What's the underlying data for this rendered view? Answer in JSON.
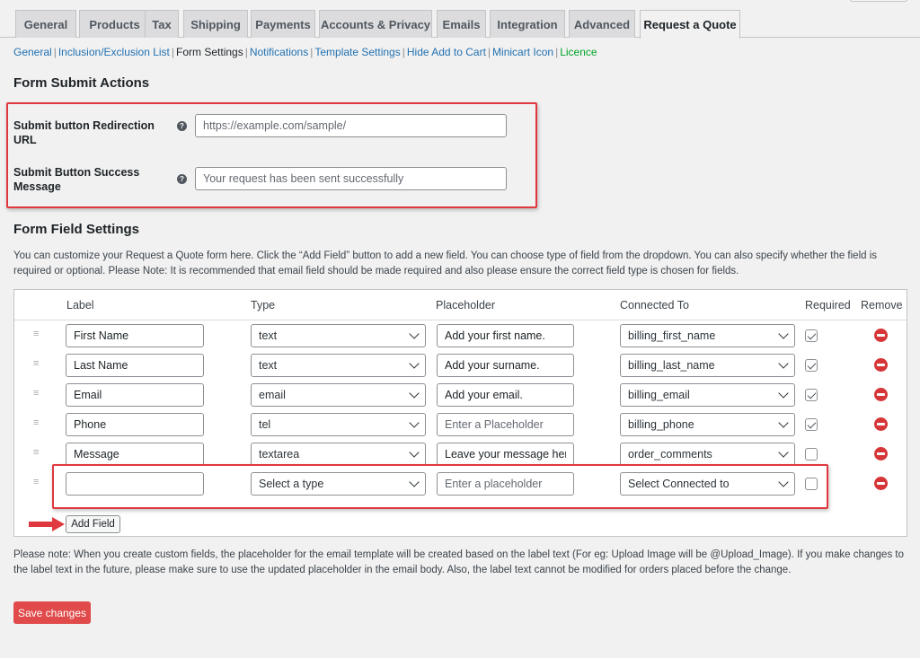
{
  "tabs": [
    "General",
    "Products",
    "Tax",
    "Shipping",
    "Payments",
    "Accounts & Privacy",
    "Emails",
    "Integration",
    "Advanced",
    "Request a Quote"
  ],
  "active_tab": "Request a Quote",
  "subnav": {
    "items": [
      "General",
      "Inclusion/Exclusion List",
      "Form Settings",
      "Notifications",
      "Template Settings",
      "Hide Add to Cart",
      "Minicart Icon",
      "Licence"
    ],
    "current": "Form Settings"
  },
  "form_submit": {
    "heading": "Form Submit Actions",
    "redirect_label": "Submit button Redirection URL",
    "redirect_placeholder": "https://example.com/sample/",
    "success_label": "Submit Button Success Message",
    "success_placeholder": "Your request has been sent successfully",
    "help_glyph": "?"
  },
  "field_settings": {
    "heading": "Form Field Settings",
    "description": "You can customize your Request a Quote form here. Click the “Add Field” button to add a new field. You can choose type of field from the dropdown. You can also specify whether the field is required or optional. Please Note: It is recommended that email field should be made required and also please ensure the correct field type is chosen for fields.",
    "columns": [
      "Label",
      "Type",
      "Placeholder",
      "Connected To",
      "Required",
      "Remove"
    ],
    "handle_icon": "drag-handle-icon",
    "remove_icon": "remove-circle-icon",
    "rows": [
      {
        "label": "First Name",
        "type": "text",
        "placeholder": "Add your first name.",
        "placeholder_is_hint": false,
        "connected": "billing_first_name",
        "required": true
      },
      {
        "label": "Last Name",
        "type": "text",
        "placeholder": "Add your surname.",
        "placeholder_is_hint": false,
        "connected": "billing_last_name",
        "required": true
      },
      {
        "label": "Email",
        "type": "email",
        "placeholder": "Add your email.",
        "placeholder_is_hint": false,
        "connected": "billing_email",
        "required": true
      },
      {
        "label": "Phone",
        "type": "tel",
        "placeholder": "Enter a Placeholder",
        "placeholder_is_hint": true,
        "connected": "billing_phone",
        "required": true
      },
      {
        "label": "Message",
        "type": "textarea",
        "placeholder": "Leave your message here.",
        "placeholder_is_hint": false,
        "connected": "order_comments",
        "required": false
      },
      {
        "label": "",
        "type": "Select a type",
        "placeholder": "Enter a placeholder",
        "placeholder_is_hint": true,
        "connected": "Select Connected to",
        "required": false
      }
    ],
    "add_button": "Add Field"
  },
  "note": "Please note: When you create custom fields, the placeholder for the email template will be created based on the label text (For eg: Upload Image will be @Upload_Image). If you make changes to the label text in the future, please make sure to use the updated placeholder in the email body. Also, the label text cannot be modified for orders placed before the change.",
  "save_button": "Save changes",
  "colors": {
    "accent_link": "#2271b1",
    "licence_link": "#00a32a",
    "highlight_box": "#e0383e",
    "remove_icon": "#d63638",
    "save_button": "#e04a4a"
  }
}
